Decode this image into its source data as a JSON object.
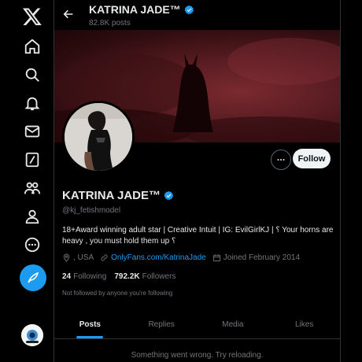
{
  "nav": {
    "items": [
      "x-logo-icon",
      "home-icon",
      "explore-icon",
      "notifications-icon",
      "messages-icon",
      "grok-icon",
      "communities-icon",
      "profile-icon",
      "more-icon"
    ],
    "post_icon": "compose-icon"
  },
  "header": {
    "name": "KATRINA JADE™",
    "posts_count": "82.8K posts"
  },
  "profile": {
    "name": "KATRINA JADE™",
    "handle": "@kj_fetishmodel",
    "bio": "18+Award winning adult star | Creative Intuit | IG: EvilGirlKJ | ⸮ Your horns are heavy , you must hold them up ⸮",
    "location": ", USA",
    "link": "OnlyFans.com/KatrinaJade",
    "joined": "Joined February 2014",
    "following_count": "24",
    "following_label": "Following",
    "followers_count": "792.2K",
    "followers_label": "Followers",
    "followed_by": "Not followed by anyone you're following"
  },
  "actions": {
    "follow_label": "Follow"
  },
  "tabs": [
    {
      "label": "Posts",
      "active": true
    },
    {
      "label": "Replies",
      "active": false
    },
    {
      "label": "Media",
      "active": false
    },
    {
      "label": "Likes",
      "active": false
    }
  ],
  "error_message": "Something went wrong. Try reloading.",
  "colors": {
    "accent": "#1d9bf0",
    "background": "#000000",
    "muted": "#71767b",
    "banner": "#6b2228"
  }
}
